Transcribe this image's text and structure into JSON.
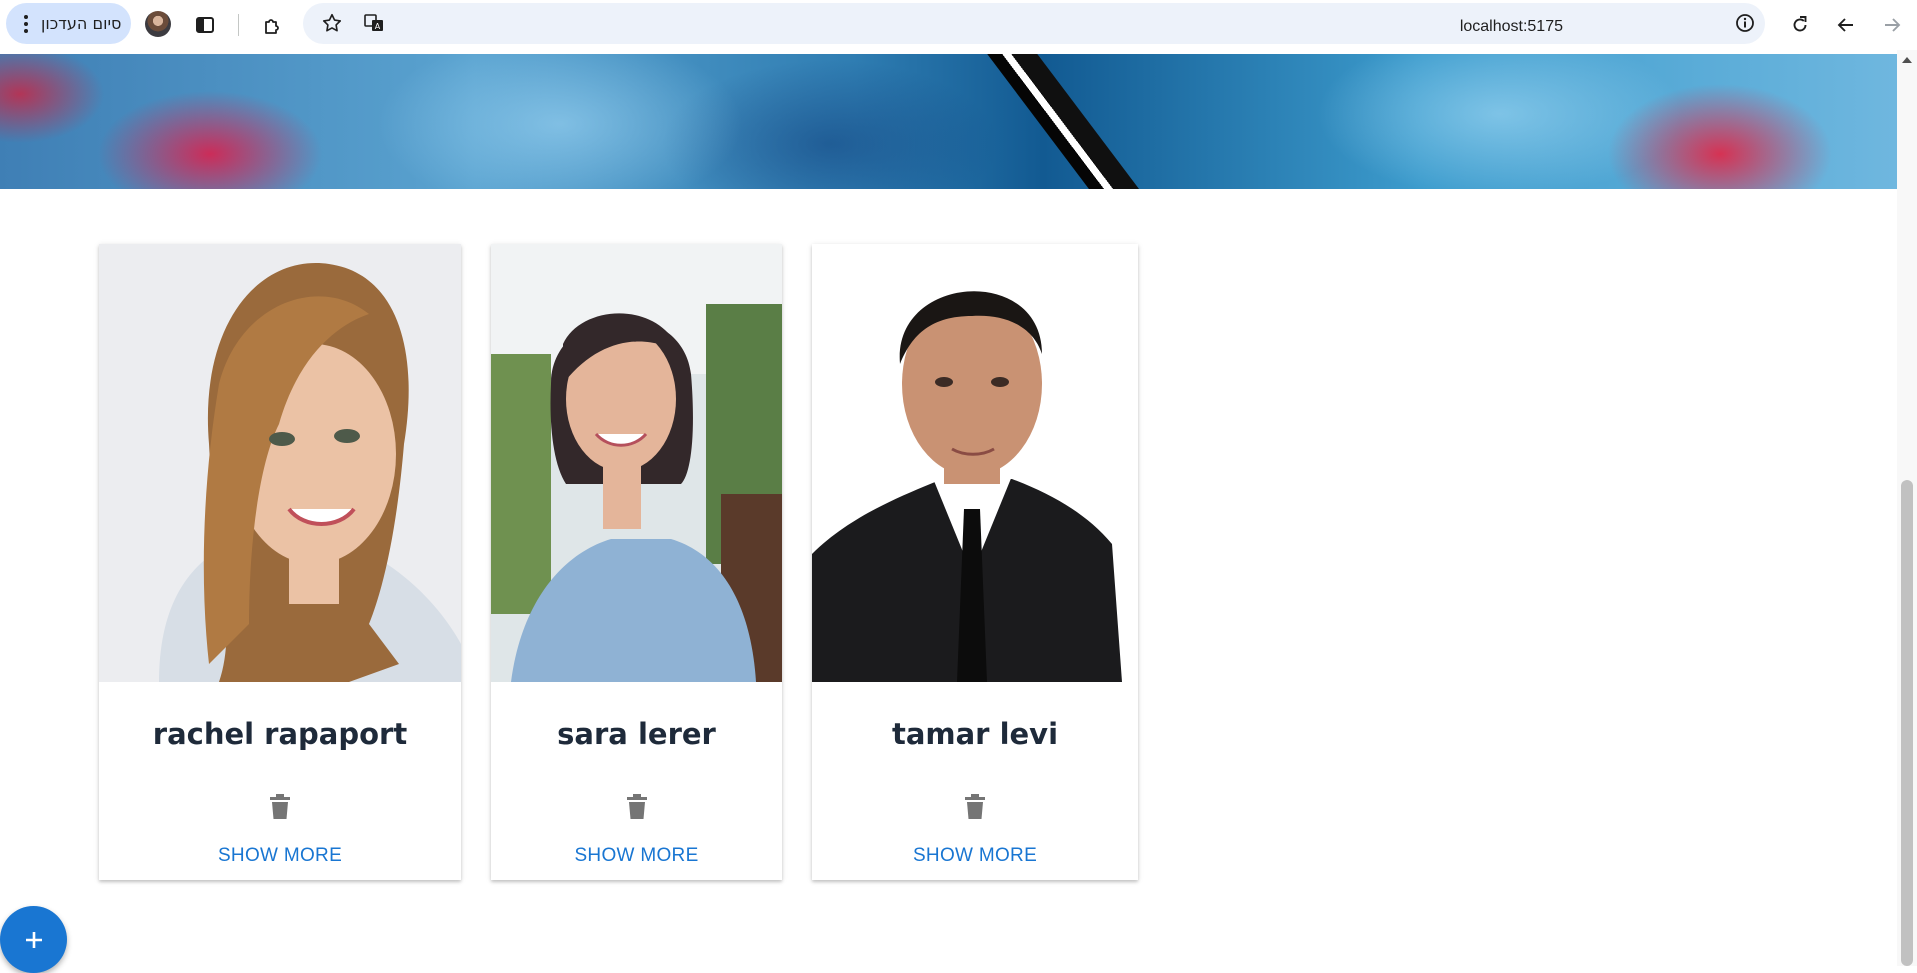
{
  "browser": {
    "update_button_label": "סיום העדכון",
    "url": "localhost:5175"
  },
  "page": {
    "banner_alt": "",
    "cards": [
      {
        "name": "rachel rapaport",
        "action_label": "SHOW MORE"
      },
      {
        "name": "sara lerer",
        "action_label": "SHOW MORE"
      },
      {
        "name": "tamar levi",
        "action_label": "SHOW MORE"
      }
    ],
    "fab_icon": "plus-icon"
  },
  "colors": {
    "accent": "#1976d2",
    "chrome_pill": "#d3e3fd",
    "omnibox": "#edf2fa",
    "heading": "#1e2a3a"
  }
}
